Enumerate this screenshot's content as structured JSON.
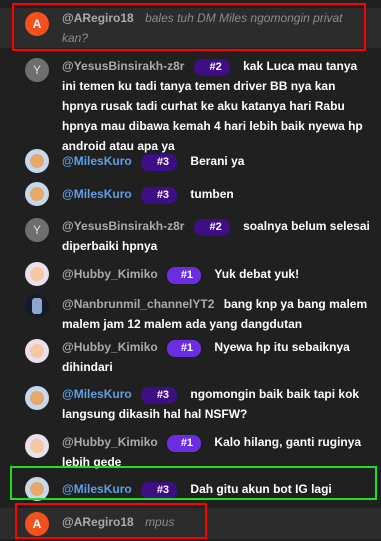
{
  "messages": [
    {
      "author": "@ARegiro18",
      "badge": "",
      "text": "bales tuh DM Miles ngomongin privat kan?",
      "avatar": "A",
      "avatar_color": "#f4511e"
    },
    {
      "author": "@YesusBinsirakh-z8r",
      "badge": "#2",
      "text": "kak Luca mau tanya ini temen ku tadi tanya temen driver BB nya kan hpnya rusak tadi curhat ke aku katanya hari Rabu hpnya mau dibawa kemah 4 hari lebih baik nyewa hp android atau apa ya",
      "avatar": "Y",
      "avatar_color": "#6e6e6e"
    },
    {
      "author": "@MilesKuro",
      "badge": "#3",
      "text": "Berani ya"
    },
    {
      "author": "@MilesKuro",
      "badge": "#3",
      "text": "tumben"
    },
    {
      "author": "@YesusBinsirakh-z8r",
      "badge": "#2",
      "text": "soalnya belum selesai diperbaiki hpnya",
      "avatar": "Y",
      "avatar_color": "#6e6e6e"
    },
    {
      "author": "@Hubby_Kimiko",
      "badge": "#1",
      "text": "Yuk debat yuk!"
    },
    {
      "author": "@Nanbrunmil_channelYT2",
      "badge": "",
      "text": "bang knp ya bang malem malem jam 12 malem ada yang dangdutan"
    },
    {
      "author": "@Hubby_Kimiko",
      "badge": "#1",
      "text": "Nyewa hp itu sebaiknya dihindari"
    },
    {
      "author": "@MilesKuro",
      "badge": "#3",
      "text": "ngomongin baik baik tapi kok langsung dikasih hal hal NSFW?"
    },
    {
      "author": "@Hubby_Kimiko",
      "badge": "#1",
      "text": "Kalo hilang, ganti ruginya lebih gede"
    },
    {
      "author": "@MilesKuro",
      "badge": "#3",
      "text": "Dah gitu akun bot IG lagi"
    },
    {
      "author": "@ARegiro18",
      "badge": "",
      "text": "mpus",
      "avatar": "A",
      "avatar_color": "#f4511e"
    }
  ],
  "colors": {
    "highlight_red": "#ff0000",
    "highlight_green": "#22dd22",
    "member_badge": "#3e0e86",
    "member_badge_top": "#6b2de0",
    "moderator_blue": "#5e9fe8"
  }
}
